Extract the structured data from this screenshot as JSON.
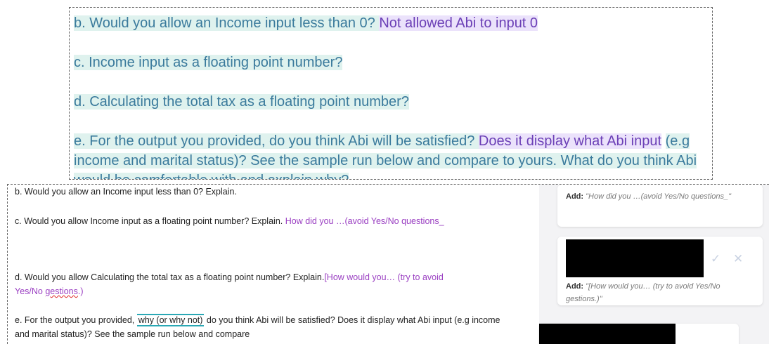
{
  "top_excerpt": {
    "q_b": {
      "prefix": "b. Would you allow an Income input less than 0? ",
      "comment": "Not allowed Abi to input 0"
    },
    "q_c": "c. Income input as a floating point number?",
    "q_d": "d. Calculating the total tax as a floating point number?",
    "q_e": {
      "prefix": "e. For the output you provided, do you think Abi will be satisfied? ",
      "comment": "Does it display what Abi input",
      "rest": "(e.g income and marital status)? See the sample run below and compare to yours. What do you think Abi would be comfortable with and explain why?"
    }
  },
  "document": {
    "q_b": "b. Would you allow an Income input less than 0?  Explain.",
    "q_c": {
      "text": "c. Would you allow Income input as a floating point number? Explain. ",
      "suggestion": "How did you …(avoid Yes/No questions_"
    },
    "q_d": {
      "text": "d. Would you allow Calculating the total tax as a floating point number? Explain.",
      "suggestion_start": "[How would you… (try to avoid Yes/No ",
      "suggestion_misspelled": "gestions",
      "suggestion_end": ".)"
    },
    "q_e": {
      "text_before": "e. For the output you provided, ",
      "inserted": "why (or why not)",
      "text_after": " do you think Abi will be satisfied? Does it display what Abi input (e.g income and marital status)? See the sample run below and compare"
    }
  },
  "comments": [
    {
      "label": "Add:",
      "text": "\"How did you …(avoid Yes/No questions_\""
    },
    {
      "label": "Add:",
      "text": "\"[How would you… (try to avoid Yes/No gestions.)\"",
      "accept_icon": "check-icon",
      "reject_icon": "close-icon",
      "accept_glyph": "✓",
      "reject_glyph": "✕"
    }
  ],
  "colors": {
    "highlight_green": "#dff2ee",
    "highlight_purple": "#ebe2fb",
    "suggestion_purple": "#9a3fc2",
    "insert_outline": "#2aa8b5"
  }
}
